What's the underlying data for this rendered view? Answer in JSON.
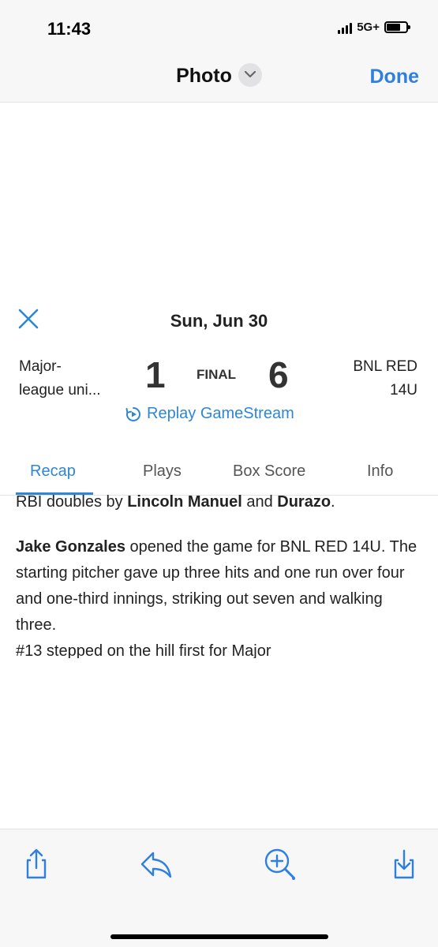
{
  "status": {
    "time": "11:43",
    "network": "5G+"
  },
  "nav": {
    "title": "Photo",
    "done_label": "Done"
  },
  "game": {
    "date": "Sun, Jun 30",
    "team_left": "Major-league uni...",
    "team_left_line1": "Major-",
    "team_left_line2": "league uni...",
    "team_right_line1": "BNL RED",
    "team_right_line2": "14U",
    "score_left": "1",
    "score_right": "6",
    "status": "FINAL",
    "replay_label": "Replay GameStream"
  },
  "tabs": [
    {
      "label": "Recap",
      "active": true
    },
    {
      "label": "Plays",
      "active": false
    },
    {
      "label": "Box Score",
      "active": false
    },
    {
      "label": "Info",
      "active": false
    }
  ],
  "article": {
    "p1_prefix": "RBI doubles by ",
    "p1_name1": "Lincoln Manuel",
    "p1_mid": " and ",
    "p1_name2": "Durazo",
    "p1_suffix": ".",
    "p2_name": "Jake Gonzales",
    "p2_text": " opened the game for BNL RED 14U. The starting pitcher gave up three hits and one run over four and one-third innings, striking out seven and walking three.",
    "p3_cut": "#13 stepped on the hill first for Major"
  },
  "toolbar": {
    "icons": [
      "share-icon",
      "reply-icon",
      "markup-icon",
      "save-icon"
    ]
  },
  "colors": {
    "accent": "#2e86d6",
    "ios_blue": "#2f7fdf"
  }
}
